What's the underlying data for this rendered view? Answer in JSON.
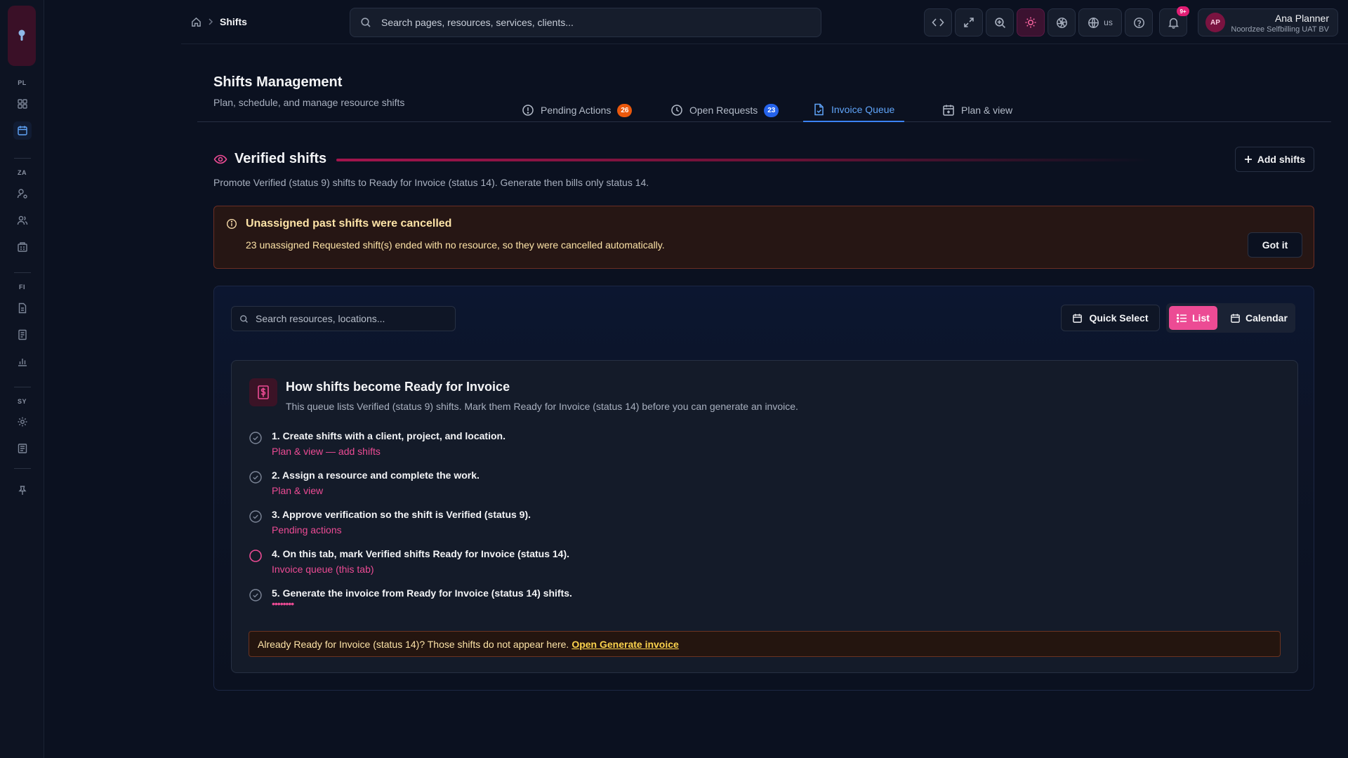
{
  "rail": {
    "sections": [
      "PL",
      "ZA",
      "FI",
      "SY"
    ],
    "icons": [
      "dashboard-icon",
      "calendar-icon",
      "user-settings-icon",
      "users-icon",
      "building-icon",
      "document-icon",
      "receipt-icon",
      "bar-chart-icon",
      "gear-icon",
      "book-icon",
      "pin-icon"
    ]
  },
  "breadcrumb": {
    "current": "Shifts"
  },
  "topbar": {
    "search_placeholder": "Search pages, resources, services, clients...",
    "language": "us",
    "notifications_badge": "9+",
    "user": {
      "initials": "AP",
      "name": "Ana Planner",
      "org": "Noordzee Selfbilling UAT BV"
    }
  },
  "page": {
    "title": "Shifts Management",
    "subtitle": "Plan, schedule, and manage resource shifts"
  },
  "tabs": [
    {
      "label": "Pending Actions",
      "count": "26",
      "color": "#ea580c"
    },
    {
      "label": "Open Requests",
      "count": "23",
      "color": "#2563eb"
    },
    {
      "label": "Invoice Queue",
      "count": "",
      "active": true
    },
    {
      "label": "Plan & view",
      "count": ""
    }
  ],
  "section": {
    "title": "Verified shifts",
    "add_button": "Add shifts",
    "description": "Promote Verified (status 9) shifts to Ready for Invoice (status 14). Generate then bills only status 14."
  },
  "alert": {
    "title": "Unassigned past shifts were cancelled",
    "body": "23 unassigned Requested shift(s) ended with no resource, so they were cancelled automatically.",
    "button": "Got it"
  },
  "panel": {
    "search_placeholder": "Search resources, locations...",
    "quick_select": "Quick Select",
    "view_list": "List",
    "view_calendar": "Calendar"
  },
  "guide": {
    "title": "How shifts become Ready for Invoice",
    "description": "This queue lists Verified (status 9) shifts. Mark them Ready for Invoice (status 14) before you can generate an invoice.",
    "steps": [
      {
        "text": "1. Create shifts with a client, project, and location.",
        "link": "Plan & view — add shifts",
        "state": "done"
      },
      {
        "text": "2. Assign a resource and complete the work.",
        "link": "Plan & view",
        "state": "done"
      },
      {
        "text": "3. Approve verification so the shift is Verified (status 9).",
        "link": "Pending actions",
        "state": "done"
      },
      {
        "text": "4. On this tab, mark Verified shifts Ready for Invoice (status 14).",
        "link": "Invoice queue (this tab)",
        "state": "pending"
      },
      {
        "text": "5. Generate the invoice from Ready for Invoice (status 14) shifts.",
        "link": "••••••••",
        "state": "done"
      }
    ],
    "note_text": "Already Ready for Invoice (status 14)? Those shifts do not appear here.",
    "note_link": "Open Generate invoice"
  }
}
